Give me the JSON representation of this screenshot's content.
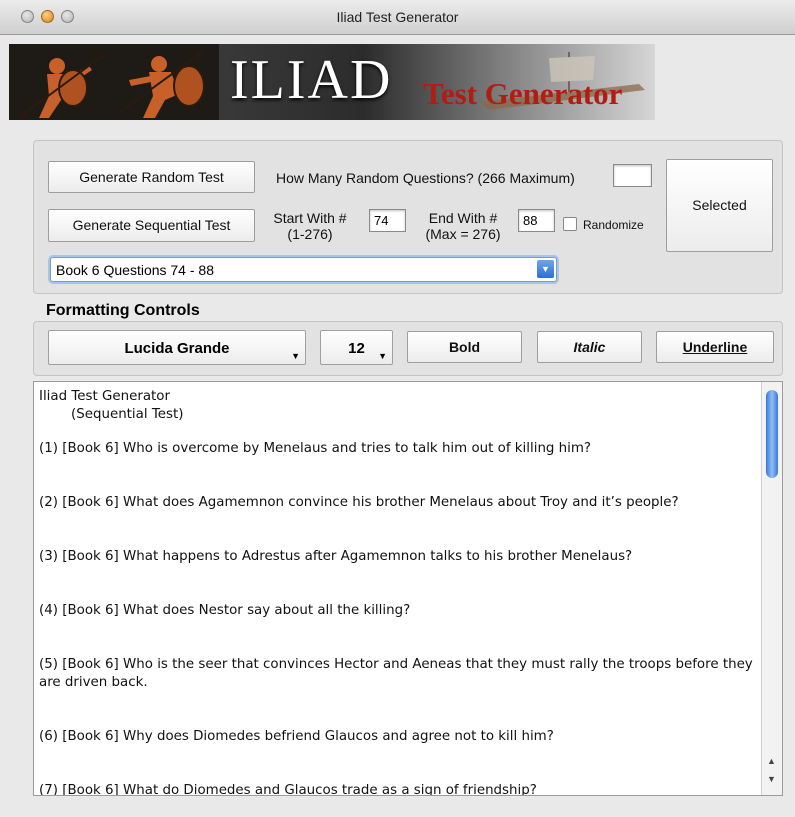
{
  "window": {
    "title": "Iliad Test Generator"
  },
  "banner": {
    "title": "ILIAD",
    "subtitle": "Test Generator"
  },
  "generator": {
    "random_button": "Generate Random Test",
    "how_many_label": "How Many Random Questions? (266 Maximum)",
    "how_many_value": "",
    "selected_button": "Selected",
    "sequential_button": "Generate Sequential Test",
    "start_label": "Start With #\n(1-276)",
    "start_value": "74",
    "end_label": "End With #\n(Max = 276)",
    "end_value": "88",
    "randomize_label": "Randomize",
    "randomize_checked": false,
    "book_select": "Book 6  Questions 74 - 88"
  },
  "formatting": {
    "title": "Formatting Controls",
    "font": "Lucida Grande",
    "size": "12",
    "bold": "Bold",
    "italic": "Italic",
    "underline": "Underline"
  },
  "document": {
    "heading": "Iliad Test Generator",
    "subheading": "(Sequential Test)",
    "questions": [
      "(1)  [Book 6]  Who is overcome by Menelaus and tries to talk him out of killing him?",
      "(2)  [Book 6]  What does Agamemnon convince his brother Menelaus about Troy and it’s people?",
      "(3)  [Book 6]  What happens to Adrestus after Agamemnon talks to his brother Menelaus?",
      "(4)  [Book 6]  What does Nestor say about all the killing?",
      "(5)  [Book 6]  Who is the seer that convinces Hector and Aeneas that they must rally the troops before they are driven back.",
      "(6)  [Book 6]  Why does Diomedes befriend Glaucos and agree not to kill him?",
      "(7)  [Book 6]  What do Diomedes and Glaucos trade as a sign of friendship?"
    ]
  },
  "colors": {
    "accent": "#3a78d4",
    "subtitle_red": "#b01d12"
  },
  "icons": {
    "dropdown": "chevron-down-icon",
    "scroll_up": "arrow-up-icon",
    "scroll_down": "arrow-down-icon"
  }
}
